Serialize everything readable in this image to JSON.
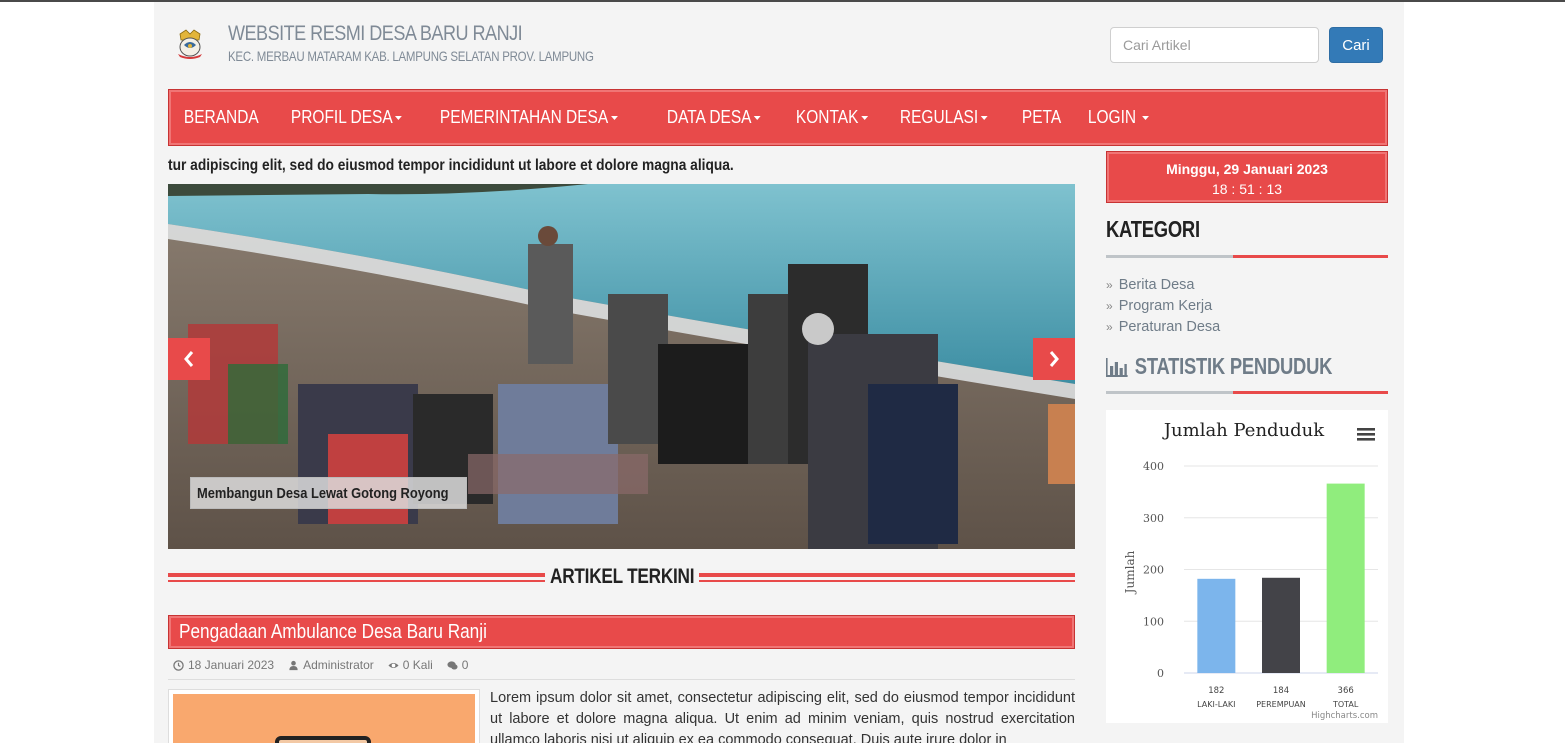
{
  "header": {
    "title": "WEBSITE RESMI DESA BARU RANJI",
    "subtitle": "KEC. MERBAU MATARAM KAB. LAMPUNG SELATAN PROV. LAMPUNG",
    "search_placeholder": "Cari Artikel",
    "search_button": "Cari"
  },
  "nav": {
    "items": [
      {
        "label": "BERANDA",
        "dropdown": false
      },
      {
        "label": "PROFIL DESA",
        "dropdown": true
      },
      {
        "label": "PEMERINTAHAN DESA",
        "dropdown": true
      },
      {
        "label": "DATA DESA",
        "dropdown": true
      },
      {
        "label": "KONTAK",
        "dropdown": true
      },
      {
        "label": "REGULASI",
        "dropdown": true
      },
      {
        "label": "PETA",
        "dropdown": false
      },
      {
        "label": "LOGIN",
        "dropdown": true
      }
    ]
  },
  "ticker": "tur adipiscing elit, sed do eiusmod tempor incididunt ut labore et dolore magna aliqua.",
  "slider": {
    "caption": "Membangun Desa Lewat Gotong Royong"
  },
  "section": {
    "title": "ARTIKEL TERKINI"
  },
  "article": {
    "title": "Pengadaan Ambulance Desa Baru Ranji",
    "date": "18 Januari 2023",
    "author": "Administrator",
    "views": "0 Kali",
    "comments": "0",
    "excerpt": "Lorem ipsum dolor sit amet, consectetur adipiscing elit, sed do eiusmod tempor incididunt ut labore et dolore magna aliqua. Ut enim ad minim veniam, quis nostrud exercitation ullamco laboris nisi ut aliquip ex ea commodo consequat. Duis aute irure dolor in"
  },
  "sidebar": {
    "date": "Minggu, 29 Januari 2023",
    "time": "18 : 51 : 13",
    "kategori_title": "KATEGORI",
    "kategori": [
      "Berita Desa",
      "Program Kerja",
      "Peraturan Desa"
    ],
    "statistik_title": "STATISTIK PENDUDUK"
  },
  "chart_data": {
    "type": "bar",
    "title": "Jumlah Penduduk",
    "ylabel": "Jumlah",
    "xlabel": "",
    "categories": [
      "LAKI-LAKI",
      "PEREMPUAN",
      "TOTAL"
    ],
    "values": [
      182,
      184,
      366
    ],
    "data_labels": [
      "182",
      "184",
      "366"
    ],
    "colors": [
      "#7cb5ec",
      "#434348",
      "#90ed7d"
    ],
    "ylim": [
      0,
      400
    ],
    "yticks": [
      0,
      100,
      200,
      300,
      400
    ],
    "grid": true,
    "credits": "Highcharts.com"
  },
  "colors": {
    "accent": "#e84a4a",
    "button": "#337ab7",
    "muted_text": "#6f7c88"
  }
}
